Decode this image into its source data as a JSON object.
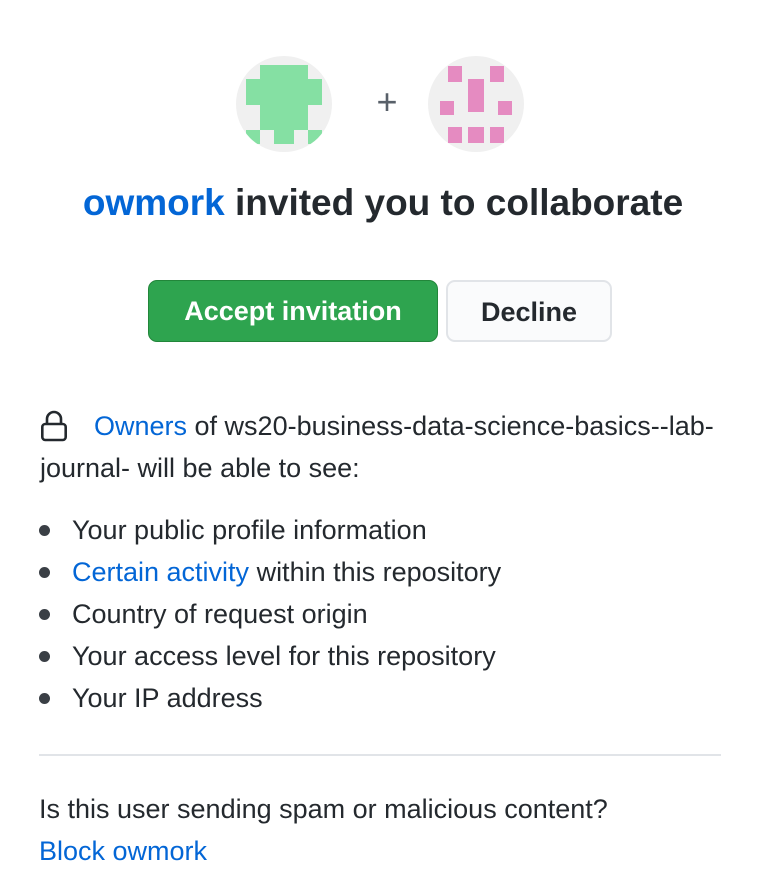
{
  "inviter": {
    "username": "owmork",
    "headline_rest": " invited you to collaborate"
  },
  "avatars": {
    "inviter_color": "#85e0a3",
    "invitee_color": "#e58bc1",
    "background": "#f0f0f0",
    "separator": "+"
  },
  "actions": {
    "accept_label": "Accept invitation",
    "decline_label": "Decline",
    "accept_color": "#2ea44f"
  },
  "visibility": {
    "owners_link": "Owners",
    "text": " of ws20-business-data-science-basics--lab-journal- will be able to see:",
    "items": [
      {
        "text": "Your public profile information"
      },
      {
        "link": "Certain activity",
        "text": " within this repository"
      },
      {
        "text": "Country of request origin"
      },
      {
        "text": "Your access level for this repository"
      },
      {
        "text": "Your IP address"
      }
    ]
  },
  "report": {
    "question": "Is this user sending spam or malicious content?",
    "block_link": "Block owmork"
  },
  "colors": {
    "link": "#0366d6",
    "text": "#24292e"
  }
}
